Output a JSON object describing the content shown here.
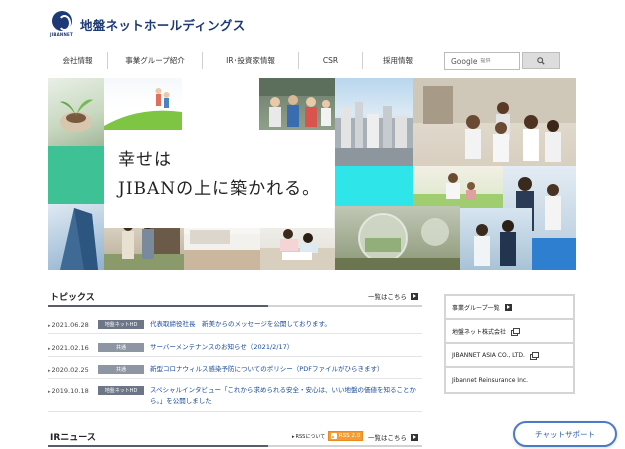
{
  "header": {
    "logo_sub": "JIBANNET",
    "company_name": "地盤ネットホールディングス"
  },
  "nav": {
    "items": [
      {
        "label": "会社情報"
      },
      {
        "label": "事業グループ紹介"
      },
      {
        "label": "IR･投資家情報"
      },
      {
        "label": "CSR"
      },
      {
        "label": "採用情報"
      }
    ]
  },
  "search": {
    "google_label": "Google",
    "placeholder": "提供"
  },
  "hero": {
    "catch_line1": "幸せは",
    "catch_line2": "JIBANの上に築かれる。"
  },
  "topics": {
    "title": "トピックス",
    "more_label": "一覧はこちら",
    "items": [
      {
        "date": "2021.06.28",
        "badge": "地盤ネットHD",
        "badge_color": "#6d7686",
        "title": "代表取締役社長　新美からのメッセージを公開しております。"
      },
      {
        "date": "2021.02.16",
        "badge": "共通",
        "badge_color": "#8e96a3",
        "title": "サーバーメンテナンスのお知らせ（2021/2/17）"
      },
      {
        "date": "2020.02.25",
        "badge": "共通",
        "badge_color": "#8e96a3",
        "title": "新型コロナウィルス感染予防についてのポリシー（PDFファイルがひらきます）"
      },
      {
        "date": "2019.10.18",
        "badge": "地盤ネットHD",
        "badge_color": "#6d7686",
        "title": "スペシャルインタビュー「これから求められる安全・安心は、いい地盤の価値を知ることから。」を公開しました"
      }
    ]
  },
  "side_links": {
    "items": [
      {
        "label": "事業グループ一覧",
        "icon": "arrow-icon"
      },
      {
        "label": "地盤ネット株式会社",
        "icon": "external-link-icon"
      },
      {
        "label": "JIBANNET ASIA CO., LTD.",
        "icon": "external-link-icon"
      },
      {
        "label": "Jibannet Reinsurance Inc.",
        "icon": ""
      }
    ]
  },
  "ir_news": {
    "title": "IRニュース",
    "rss_about": "RSSについて",
    "rss_badge": "RSS 2.0",
    "more_label": "一覧はこちら"
  },
  "chat": {
    "label": "チャットサポート"
  }
}
